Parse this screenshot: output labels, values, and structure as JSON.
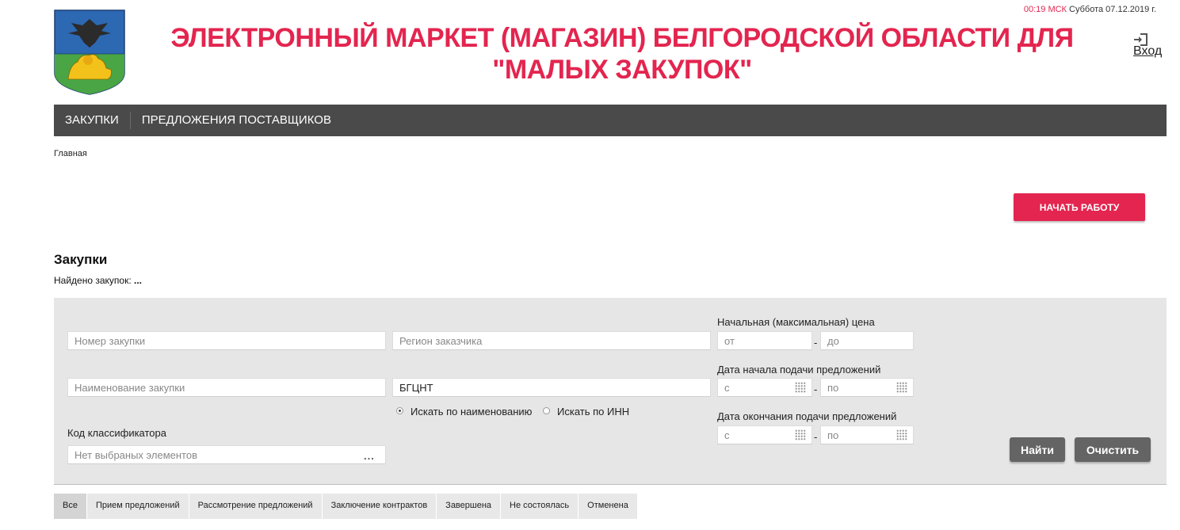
{
  "header": {
    "title_line1": "ЭЛЕКТРОННЫЙ МАРКЕТ (МАГАЗИН) БЕЛГОРОДСКОЙ ОБЛАСТИ ДЛЯ",
    "title_line2": "\"МАЛЫХ ЗАКУПОК\"",
    "time": "00:19 МСК",
    "date": "Суббота 07.12.2019 г.",
    "login_label": "Вход",
    "logo_icon": "coat-of-arms-icon",
    "login_icon": "sign-in-icon"
  },
  "nav": {
    "items": [
      "ЗАКУПКИ",
      "ПРЕДЛОЖЕНИЯ ПОСТАВЩИКОВ"
    ]
  },
  "breadcrumb": "Главная",
  "start_button": "НАЧАТЬ РАБОТУ",
  "section": {
    "title": "Закупки",
    "found_label": "Найдено закупок:",
    "found_value": "..."
  },
  "filters": {
    "number_placeholder": "Номер закупки",
    "region_placeholder": "Регион заказчика",
    "name_placeholder": "Наименование закупки",
    "customer_value": "БГЦНТ",
    "radio_by_name": "Искать по наименованию",
    "radio_by_inn": "Искать по ИНН",
    "radio_selected": "by_name",
    "classifier_label": "Код классификатора",
    "classifier_placeholder": "Нет выбраных элементов",
    "classifier_dots": "...",
    "price_label": "Начальная (максимальная) цена",
    "price_from": "от",
    "price_to": "до",
    "start_date_label": "Дата начала подачи предложений",
    "end_date_label": "Дата окончания подачи предложений",
    "date_from": "с",
    "date_to": "по",
    "dash": "-",
    "find_button": "Найти",
    "clear_button": "Очистить"
  },
  "tabs": [
    "Все",
    "Прием предложений",
    "Рассмотрение предложений",
    "Заключение контрактов",
    "Завершена",
    "Не состоялась",
    "Отменена"
  ],
  "active_tab": "Все",
  "colors": {
    "accent": "#e3254f",
    "nav_bg": "#4a4a4a",
    "panel_bg": "#e6e6e6",
    "button_grey": "#646464"
  }
}
